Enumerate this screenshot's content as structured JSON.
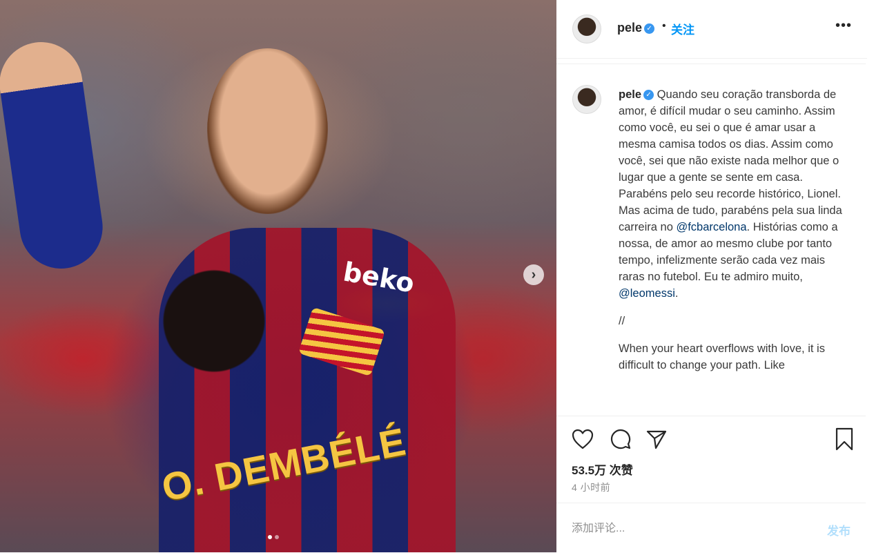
{
  "post": {
    "username": "pele",
    "dot_separator": "•",
    "follow_label": "关注",
    "more_label": "•••",
    "next_arrow": "›",
    "caption_pt_before_club": "Quando seu coração transborda de amor, é difícil mudar o seu caminho. Assim como você, eu sei o que é amar usar a mesma camisa todos os dias. Assim como você, sei que não existe nada melhor que o lugar que a gente se sente em casa. Parabéns pelo seu recorde histórico, Lionel. Mas acima de tudo, parabéns pela sua linda carreira no",
    "mention_club": "@fcbarcelona",
    "caption_pt_after_club": ". Histórias como a nossa, de amor ao mesmo clube por tanto tempo, infelizmente serão cada vez mais raras no futebol. Eu te admiro muito,",
    "mention_player": "@leomessi",
    "caption_pt_end": ".",
    "separator": "//",
    "caption_en": "When your heart overflows with love, it is difficult to change your path. Like",
    "likes": "53.5万 次赞",
    "timestamp": "4 小时前",
    "comment_placeholder": "添加评论...",
    "post_label": "发布",
    "photo_text_name": "O. DEMBÉLÉ",
    "photo_text_brand": "beko"
  },
  "colors": {
    "link_blue": "#0095f6",
    "post_button_disabled": "#b2dffc",
    "verified_blue": "#3897f0"
  }
}
